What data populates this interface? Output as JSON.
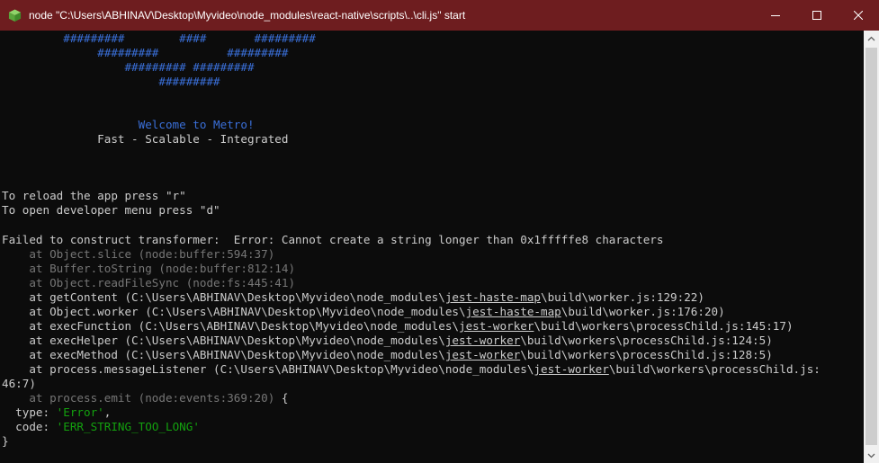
{
  "window": {
    "title": "node  \"C:\\Users\\ABHINAV\\Desktop\\Myvideo\\node_modules\\react-native\\scripts\\..\\cli.js\" start",
    "icon": "node-cube-icon",
    "accent_color": "#6e1d1f"
  },
  "terminal": {
    "metro_logo": [
      "         #########        ####       #########",
      "              #########          #########",
      "                  ######### #########",
      "                       #########"
    ],
    "welcome": "                    Welcome to Metro!",
    "tagline": "              Fast - Scalable - Integrated",
    "reload_hint": "To reload the app press \"r\"",
    "devmenu_hint": "To open developer menu press \"d\"",
    "error_message": "Failed to construct transformer:  Error: Cannot create a string longer than 0x1fffffe8 characters",
    "stack": {
      "object_slice": "    at Object.slice (node:buffer:594:37)",
      "buffer_tostring": "    at Buffer.toString (node:buffer:812:14)",
      "read_file_sync": "    at Object.readFileSync (node:fs:445:41)",
      "get_content": {
        "pre": "    at getContent (C:\\Users\\ABHINAV\\Desktop\\Myvideo\\node_modules\\",
        "link": "jest-haste-map",
        "post": "\\build\\worker.js:129:22)"
      },
      "object_worker": {
        "pre": "    at Object.worker (C:\\Users\\ABHINAV\\Desktop\\Myvideo\\node_modules\\",
        "link": "jest-haste-map",
        "post": "\\build\\worker.js:176:20)"
      },
      "exec_function": {
        "pre": "    at execFunction (C:\\Users\\ABHINAV\\Desktop\\Myvideo\\node_modules\\",
        "link": "jest-worker",
        "post": "\\build\\workers\\processChild.js:145:17)"
      },
      "exec_helper": {
        "pre": "    at execHelper (C:\\Users\\ABHINAV\\Desktop\\Myvideo\\node_modules\\",
        "link": "jest-worker",
        "post": "\\build\\workers\\processChild.js:124:5)"
      },
      "exec_method": {
        "pre": "    at execMethod (C:\\Users\\ABHINAV\\Desktop\\Myvideo\\node_modules\\",
        "link": "jest-worker",
        "post": "\\build\\workers\\processChild.js:128:5)"
      },
      "message_listener": {
        "pre": "    at process.messageListener (C:\\Users\\ABHINAV\\Desktop\\Myvideo\\node_modules\\",
        "link": "jest-worker",
        "post": "\\build\\workers\\processChild.js:",
        "wrap": "46:7)"
      },
      "process_emit": {
        "ghost": "    at process.emit (node:events:369:20)",
        "tail": " {"
      }
    },
    "type_line": {
      "key": "  type: ",
      "value": "'Error'",
      "tail": ","
    },
    "code_line": {
      "key": "  code: ",
      "value": "'ERR_STRING_TOO_LONG'"
    },
    "closing_brace": "}"
  }
}
